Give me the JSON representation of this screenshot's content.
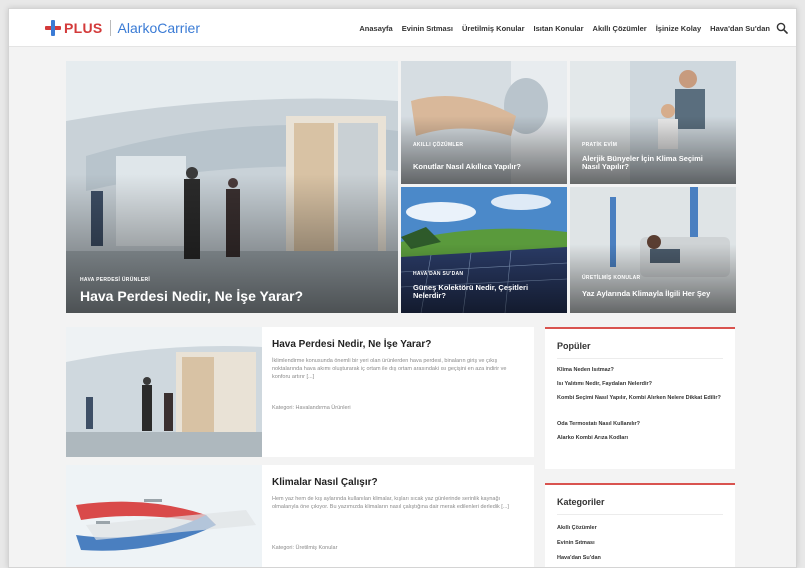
{
  "header": {
    "logo_plus": "PLUS",
    "logo_brand": "AlarkoCarrier",
    "nav": [
      "Anasayfa",
      "Evinin Sıtması",
      "Üretilmiş Konular",
      "Isıtan Konular",
      "Akıllı Çözümler",
      "İşinize Kolay",
      "Hava'dan Su'dan"
    ]
  },
  "hero": {
    "main": {
      "category": "HAVA PERDESİ ÜRÜNLERİ",
      "title": "Hava Perdesi Nedir, Ne İşe Yarar?"
    },
    "tile_2": {
      "category": "AKILLI ÇÖZÜMLER",
      "title": "Konutlar Nasıl Akıllıca Yapılır?"
    },
    "tile_3": {
      "category": "PRATİK EVİM",
      "title": "Alerjik Bünyeler İçin Klima Seçimi Nasıl Yapılır?"
    },
    "tile_4": {
      "category": "HAVA'DAN SU'DAN",
      "title": "Güneş Kolektörü Nedir, Çeşitleri Nelerdir?"
    },
    "tile_5": {
      "category": "ÜRETİLMİŞ KONULAR",
      "title": "Yaz Aylarında Klimayla İlgili Her Şey"
    }
  },
  "articles": [
    {
      "title": "Hava Perdesi Nedir, Ne İşe Yarar?",
      "excerpt": "İklimlendirme konusunda önemli bir yeri olan ürünlerden hava perdesi, binaların giriş ve çıkış noktalarında hava akımı oluşturarak iç ortam ile dış ortam arasındaki ısı geçişini en aza indirir ve konforu artırır [...]",
      "meta": "Kategori: Havalandırma Ürünleri"
    },
    {
      "title": "Klimalar Nasıl Çalışır?",
      "excerpt": "Hem yaz hem de kış aylarında kullanılan klimalar, kışları sıcak yaz günlerinde serinlik kaynağı olmalarıyla öne çıkıyor. Bu yazımızda klimaların nasıl çalıştığına dair merak edilenleri derledik [...]",
      "meta": "Kategori: Üretilmiş Konular"
    }
  ],
  "sidebar": {
    "popular_title": "Popüler",
    "popular_items": [
      "Klima Neden Isıtmaz?",
      "Isı Yalıtımı Nedir, Faydaları Nelerdir?",
      "Kombi Seçimi Nasıl Yapılır, Kombi Alırken Nelere Dikkat Edilir?",
      "Oda Termostatı Nasıl Kullanılır?",
      "Alarko Kombi Arıza Kodları"
    ],
    "categories_title": "Kategoriler",
    "category_items": [
      "Akıllı Çözümler",
      "Evinin Sıtması",
      "Hava'dan Su'dan"
    ]
  },
  "colors": {
    "accent": "#d9534f",
    "brand_blue": "#3a7bd5",
    "brand_red": "#d33a3a"
  }
}
